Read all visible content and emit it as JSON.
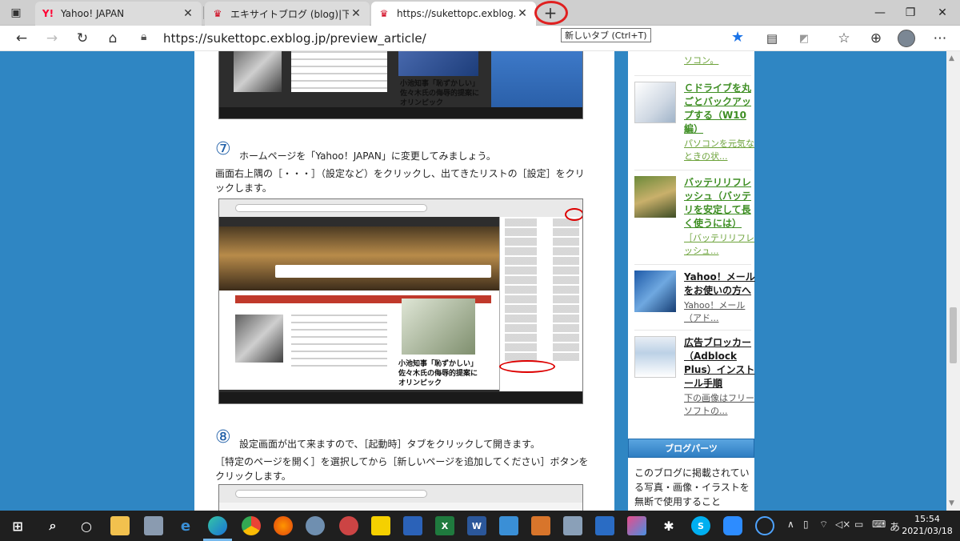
{
  "tabs": [
    {
      "label": "Yahoo! JAPAN",
      "favicon": "Y!",
      "favicon_color": "#ff0033",
      "active": false
    },
    {
      "label": "エキサイトブログ (blog)|下書き編集",
      "favicon": "excite-icon",
      "favicon_color": "#d0021b",
      "active": false
    },
    {
      "label": "https://sukettopc.exblog.jp/previ",
      "favicon": "excite-icon",
      "favicon_color": "#d0021b",
      "active": true
    }
  ],
  "new_tab_symbol": "+",
  "tooltip": "新しいタブ (Ctrl+T)",
  "address": {
    "url": "https://sukettopc.exblog.jp/preview_article/"
  },
  "article": {
    "step7": {
      "number": "⑦",
      "title": "ホームページを「Yahoo！JAPAN」に変更してみましょう。",
      "body": "画面右上隅の［・・・］（設定など）をクリックし、出てきたリストの［設定］をクリックします。"
    },
    "screenshot_headline": "小池知事「恥ずかしい」 佐々木氏の侮辱的提案に オリンピック",
    "step8": {
      "number": "⑧",
      "title": "設定画面が出て来ますので、［起動時］タブをクリックして開きます。",
      "body": "［特定のページを開く］を選択してから［新しいページを追加してください］ボタンをクリックします。"
    }
  },
  "sidebar": {
    "items": [
      {
        "title": "",
        "sub": "ソコン。"
      },
      {
        "title": "Ｃドライブを丸ごとバックアップする（W10編）",
        "sub": "パソコンを元気なときの状..."
      },
      {
        "title": "バッテリリフレッシュ（バッテリを安定して長く使うには）",
        "sub": "［バッテリリフレッシュ..."
      },
      {
        "title": "Yahoo！メールをお使いの方へ",
        "sub": "Yahoo！メール（アド..."
      },
      {
        "title": "広告ブロッカー（Adblock Plus）インストール手順",
        "sub": "下の画像はフリーソフトの..."
      }
    ],
    "parts_header": "ブログパーツ",
    "parts_text": "このブログに掲載されている写真・画像・イラストを無断で使用すること"
  },
  "taskbar": {
    "time": "15:54",
    "date": "2021/03/18",
    "ime": "あ"
  }
}
